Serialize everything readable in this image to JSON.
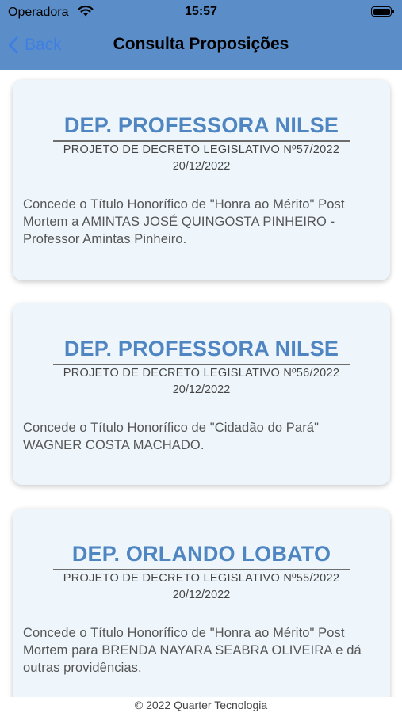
{
  "status_bar": {
    "carrier": "Operadora",
    "time": "15:57"
  },
  "nav": {
    "back_label": "Back",
    "title": "Consulta Proposições"
  },
  "propositions": [
    {
      "author": "DEP. PROFESSORA NILSE",
      "type": "PROJETO DE DECRETO LEGISLATIVO Nº57/2022",
      "date": "20/12/2022",
      "description": "Concede o Título Honorífico de \"Honra ao Mérito\" Post Mortem a AMINTAS JOSÉ QUINGOSTA PINHEIRO - Professor Amintas Pinheiro."
    },
    {
      "author": "DEP. PROFESSORA NILSE",
      "type": "PROJETO DE DECRETO LEGISLATIVO Nº56/2022",
      "date": "20/12/2022",
      "description": "Concede o Título Honorífico de \"Cidadão do Pará\" WAGNER COSTA MACHADO."
    },
    {
      "author": "DEP. ORLANDO LOBATO",
      "type": "PROJETO DE DECRETO LEGISLATIVO Nº55/2022",
      "date": "20/12/2022",
      "description": "Concede o Título Honorífico de \"Honra ao Mérito\" Post Mortem para BRENDA NAYARA SEABRA OLIVEIRA e dá outras providências."
    }
  ],
  "footer": {
    "text": "© 2022 Quarter Tecnologia"
  },
  "colors": {
    "header_bg": "#5b8ec9",
    "back_link": "#3f7fe0",
    "author_name": "#4f86c2",
    "card_bg": "#eef6fc"
  },
  "icons": {
    "back": "chevron-left-icon",
    "wifi": "wifi-icon",
    "battery": "battery-icon"
  }
}
